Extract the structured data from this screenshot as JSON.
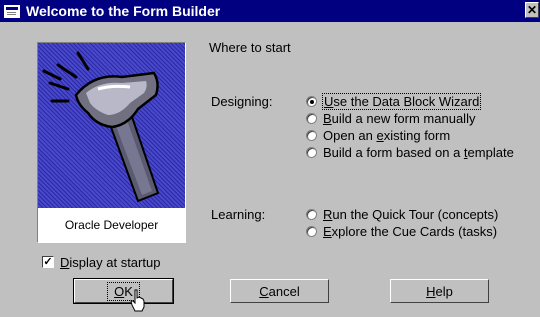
{
  "window": {
    "title": "Welcome to the Form Builder",
    "close_glyph": "✕"
  },
  "splash": {
    "caption": "Oracle Developer",
    "image_icon": "hammer-icon"
  },
  "intro": "Where to start",
  "designing": {
    "label": "Designing:",
    "options": [
      {
        "pre": "",
        "accel": "U",
        "post": "se the Data Block Wizard",
        "checked": true
      },
      {
        "pre": "",
        "accel": "B",
        "post": "uild a new form manually",
        "checked": false
      },
      {
        "pre": "Open an ",
        "accel": "e",
        "post": "xisting form",
        "checked": false
      },
      {
        "pre": "Build a form based on a ",
        "accel": "t",
        "post": "emplate",
        "checked": false
      }
    ]
  },
  "learning": {
    "label": "Learning:",
    "options": [
      {
        "pre": "",
        "accel": "R",
        "post": "un the Quick Tour (concepts)",
        "checked": false
      },
      {
        "pre": "",
        "accel": "E",
        "post": "xplore the Cue Cards (tasks)",
        "checked": false
      }
    ]
  },
  "startup_checkbox": {
    "pre": "",
    "accel": "D",
    "post": "isplay at startup",
    "checked": true,
    "check_glyph": "✓"
  },
  "buttons": {
    "ok": {
      "accel": "O",
      "post": "K"
    },
    "cancel": {
      "accel": "C",
      "post": "ancel"
    },
    "help": {
      "accel": "H",
      "post": "elp"
    }
  }
}
